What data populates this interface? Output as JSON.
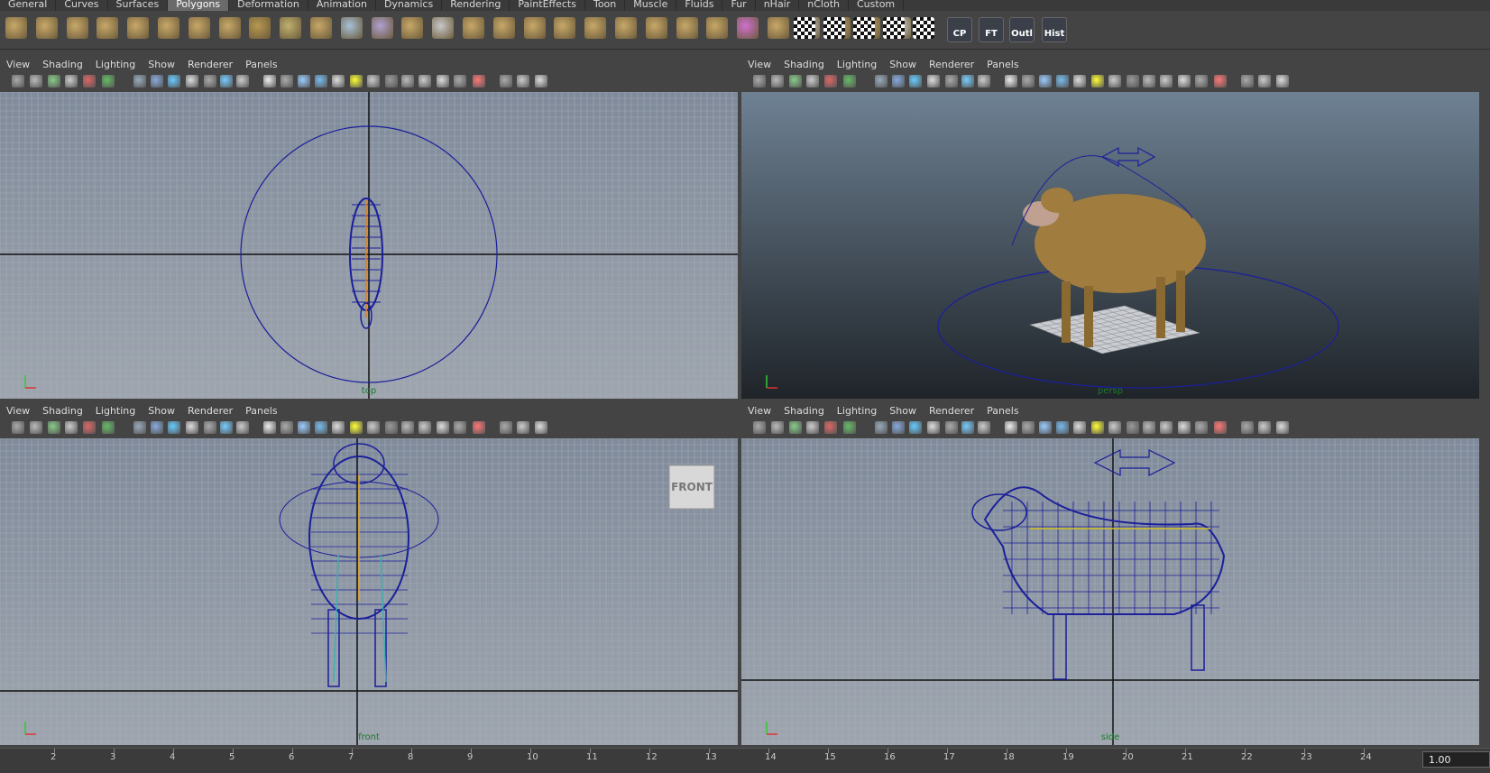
{
  "menu_tabs": [
    "General",
    "Curves",
    "Surfaces",
    "Polygons",
    "Deformation",
    "Animation",
    "Dynamics",
    "Rendering",
    "PaintEffects",
    "Toon",
    "Muscle",
    "Fluids",
    "Fur",
    "nHair",
    "nCloth",
    "Custom"
  ],
  "active_tab": "Polygons",
  "shelf_labels": {
    "cp": "CP",
    "ft": "FT",
    "outl": "Outl",
    "hist": "Hist"
  },
  "viewport_menu": [
    "View",
    "Shading",
    "Lighting",
    "Show",
    "Renderer",
    "Panels"
  ],
  "viewports": {
    "top": {
      "camera_label": "top"
    },
    "persp": {
      "camera_label": "persp"
    },
    "front": {
      "camera_label": "front",
      "view_cube": "FRONT"
    },
    "side": {
      "camera_label": "side"
    }
  },
  "timeline": {
    "ticks": [
      "2",
      "3",
      "4",
      "5",
      "6",
      "7",
      "8",
      "9",
      "10",
      "11",
      "12",
      "13",
      "14",
      "15",
      "16",
      "17",
      "18",
      "19",
      "20",
      "21",
      "22",
      "23",
      "24"
    ],
    "current_frame": "1.00"
  },
  "colors": {
    "bg": "#444444",
    "grid_bg": "#8f97a3",
    "persp_top": "#6e8193",
    "persp_bottom": "#1f2429",
    "wire": "#1b1f9a",
    "sheep": "#a07c3e"
  }
}
